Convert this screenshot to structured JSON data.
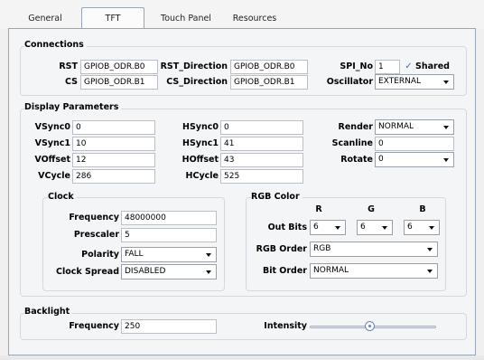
{
  "tabs": [
    {
      "label": "General"
    },
    {
      "label": "TFT"
    },
    {
      "label": "Touch Panel"
    },
    {
      "label": "Resources"
    }
  ],
  "active_tab": "TFT",
  "connections": {
    "title": "Connections",
    "rst_label": "RST",
    "rst_value": "GPIOB_ODR.B0",
    "rst_direction_label": "RST_Direction",
    "rst_direction_value": "GPIOB_ODR.B0",
    "spi_no_label": "SPI_No",
    "spi_no_value": "1",
    "shared_label": "Shared",
    "shared_checked": true,
    "cs_label": "CS",
    "cs_value": "GPIOB_ODR.B1",
    "cs_direction_label": "CS_Direction",
    "cs_direction_value": "GPIOB_ODR.B1",
    "oscillator_label": "Oscillator",
    "oscillator_value": "EXTERNAL"
  },
  "display": {
    "title": "Display Parameters",
    "vsync0_label": "VSync0",
    "vsync0_value": "0",
    "hsync0_label": "HSync0",
    "hsync0_value": "0",
    "render_label": "Render",
    "render_value": "NORMAL",
    "vsync1_label": "VSync1",
    "vsync1_value": "10",
    "hsync1_label": "HSync1",
    "hsync1_value": "41",
    "scanline_label": "Scanline",
    "scanline_value": "0",
    "voffset_label": "VOffset",
    "voffset_value": "12",
    "hoffset_label": "HOffset",
    "hoffset_value": "43",
    "rotate_label": "Rotate",
    "rotate_value": "0",
    "vcycle_label": "VCycle",
    "vcycle_value": "286",
    "hcycle_label": "HCycle",
    "hcycle_value": "525"
  },
  "clock": {
    "title": "Clock",
    "frequency_label": "Frequency",
    "frequency_value": "48000000",
    "prescaler_label": "Prescaler",
    "prescaler_value": "5",
    "polarity_label": "Polarity",
    "polarity_value": "FALL",
    "clock_spread_label": "Clock Spread",
    "clock_spread_value": "DISABLED"
  },
  "rgb": {
    "title": "RGB Color",
    "r_head": "R",
    "g_head": "G",
    "b_head": "B",
    "out_bits_label": "Out Bits",
    "r_value": "6",
    "g_value": "6",
    "b_value": "6",
    "rgb_order_label": "RGB Order",
    "rgb_order_value": "RGB",
    "bit_order_label": "Bit Order",
    "bit_order_value": "NORMAL"
  },
  "backlight": {
    "title": "Backlight",
    "frequency_label": "Frequency",
    "frequency_value": "250",
    "intensity_label": "Intensity",
    "intensity_level": 0.47
  },
  "colors": {
    "tab_border": "#9aa5b5",
    "panel_bg": "#f4f5f7",
    "check_color": "#4a6fa8"
  }
}
